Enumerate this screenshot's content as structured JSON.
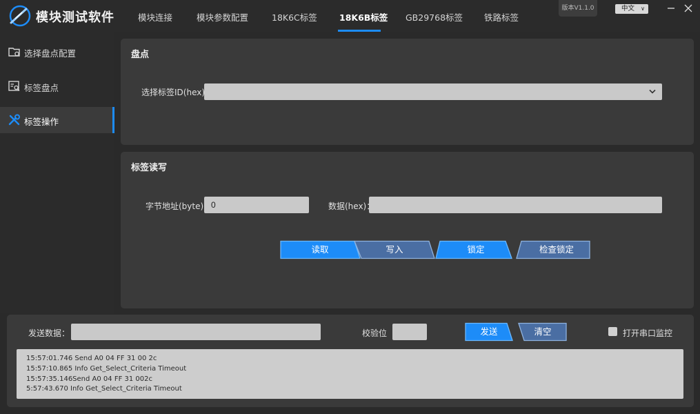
{
  "app": {
    "title": "模块测试软件",
    "version": "版本V1.1.0",
    "language": "中文"
  },
  "tabs": [
    {
      "label": "模块连接",
      "active": false
    },
    {
      "label": "模块参数配置",
      "active": false
    },
    {
      "label": "18K6C标签",
      "active": false
    },
    {
      "label": "18K6B标签",
      "active": true
    },
    {
      "label": "GB29768标签",
      "active": false
    },
    {
      "label": "铁路标签",
      "active": false
    }
  ],
  "sidebar": {
    "items": [
      {
        "label": "选择盘点配置",
        "icon": "folder-gear-icon",
        "active": false
      },
      {
        "label": "标签盘点",
        "icon": "list-search-icon",
        "active": false
      },
      {
        "label": "标签操作",
        "icon": "tools-icon",
        "active": true
      }
    ]
  },
  "inventory_panel": {
    "title": "盘点",
    "tag_id_label": "选择标签ID(hex)：",
    "tag_id_value": ""
  },
  "rw_panel": {
    "title": "标签读写",
    "address_label": "字节地址(byte)：",
    "address_value": "0",
    "data_label": "数据(hex)：",
    "data_value": "",
    "buttons": {
      "read": "读取",
      "write": "写入",
      "lock": "锁定",
      "check_lock": "检查锁定"
    }
  },
  "send_bar": {
    "send_data_label": "发送数据：",
    "send_data_value": "",
    "checksum_label": "校验位",
    "checksum_value": "",
    "send_button": "发送",
    "clear_button": "清空",
    "monitor_label": "打开串口监控",
    "monitor_checked": false
  },
  "log": [
    "15:57:01.746 Send A0 04 FF 31 00 2c",
    "15:57:10.865 Info Get_Select_Criteria Timeout",
    "15:57:35.146Send A0 04 FF 31 002c",
    "5:57:43.670 Info Get_Select_Criteria Timeout"
  ],
  "colors": {
    "accent": "#1d8cf8",
    "button_dark": "#4a6ea3",
    "background": "#2a2a2a",
    "panel": "#3a3a3a",
    "input": "#c9c9c9"
  }
}
